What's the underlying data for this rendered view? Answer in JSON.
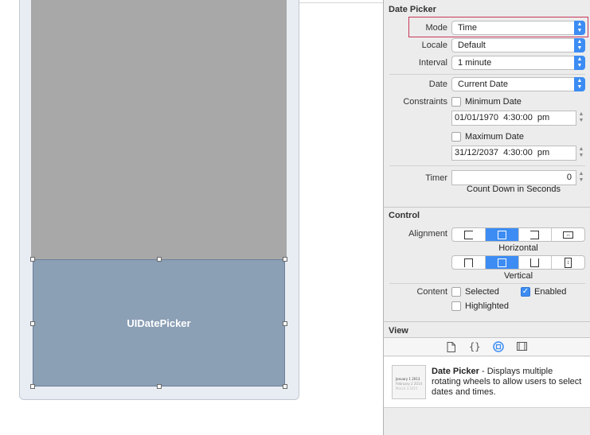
{
  "canvas": {
    "picker_label": "UIDatePicker"
  },
  "date_picker": {
    "section_title": "Date Picker",
    "mode": {
      "label": "Mode",
      "value": "Time"
    },
    "locale": {
      "label": "Locale",
      "value": "Default"
    },
    "interval": {
      "label": "Interval",
      "value": "1 minute"
    },
    "date": {
      "label": "Date",
      "value": "Current Date"
    },
    "constraints": {
      "label": "Constraints",
      "minimum_label": "Minimum Date",
      "minimum_checked": false,
      "minimum_value": "01/01/1970   4:30:00 pm",
      "maximum_label": "Maximum Date",
      "maximum_checked": false,
      "maximum_value": "31/12/2037   4:30:00 pm"
    },
    "timer": {
      "label": "Timer",
      "value": "0",
      "caption": "Count Down in Seconds"
    }
  },
  "control": {
    "section_title": "Control",
    "alignment_label": "Alignment",
    "horizontal_caption": "Horizontal",
    "vertical_caption": "Vertical",
    "horizontal_selected": 1,
    "vertical_selected": 1,
    "content_label": "Content",
    "selected_label": "Selected",
    "selected_checked": false,
    "enabled_label": "Enabled",
    "enabled_checked": true,
    "highlighted_label": "Highlighted",
    "highlighted_checked": false
  },
  "view": {
    "section_title": "View"
  },
  "library": {
    "tab_icons": [
      "file-icon",
      "braces-icon",
      "object-icon",
      "media-icon"
    ],
    "selected_tab": 2,
    "item_name": "Date Picker",
    "item_description": " - Displays multiple rotating wheels to allow users to select dates and times.",
    "thumb_lines": [
      "January  1  2013",
      "February  2  2014",
      "March  3  2015"
    ]
  },
  "colors": {
    "accent": "#3c8cf3",
    "selection_fill": "#8b9fb5",
    "gray_view": "#a8a8a8",
    "highlight_frame": "#c8375a"
  }
}
